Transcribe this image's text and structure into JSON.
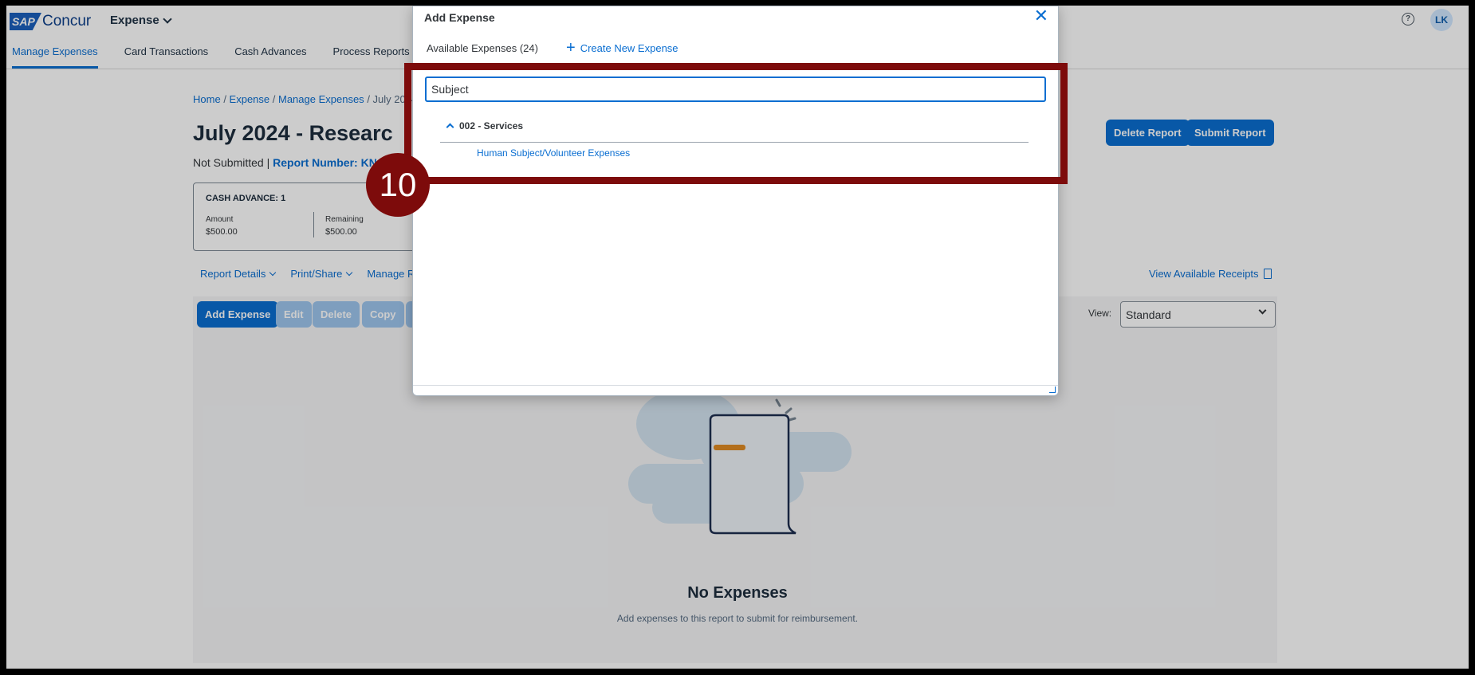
{
  "header": {
    "logo_sap": "SAP",
    "logo_concur": "Concur",
    "app_switcher": "Expense",
    "user_initials": "LK",
    "help_glyph": "?"
  },
  "nav": {
    "items": [
      "Manage Expenses",
      "Card Transactions",
      "Cash Advances",
      "Process Reports"
    ],
    "active_index": 0
  },
  "breadcrumb": {
    "home": "Home",
    "expense": "Expense",
    "manage": "Manage Expenses",
    "current": "July 2024 -"
  },
  "report": {
    "title": "July 2024 - Researc",
    "status": "Not Submitted |",
    "number_label": "Report Number: KN",
    "delete_button": "Delete Report",
    "submit_button": "Submit Report"
  },
  "cash_advance": {
    "title": "CASH ADVANCE: 1",
    "amount_label": "Amount",
    "amount_value": "$500.00",
    "remaining_label": "Remaining",
    "remaining_value": "$500.00"
  },
  "toolbar": {
    "report_details": "Report Details",
    "print_share": "Print/Share",
    "manage": "Manage R",
    "view_receipts": "View Available Receipts",
    "add_expense": "Add Expense",
    "edit": "Edit",
    "delete": "Delete",
    "copy": "Copy",
    "view_label": "View:",
    "view_value": "Standard"
  },
  "empty_state": {
    "title": "No Expenses",
    "subtitle": "Add expenses to this report to submit for reimbursement."
  },
  "modal": {
    "title": "Add Expense",
    "close_glyph": "✕",
    "available": "Available Expenses (24)",
    "create_new": "Create New Expense",
    "search_value": "Subject",
    "group_label": "002 - Services",
    "option": "Human Subject/Volunteer Expenses"
  },
  "annotation": {
    "step": "10",
    "color": "#7d0b0b"
  },
  "colors": {
    "accent": "#0a6ed1",
    "disabled_button": "#9ec6ee"
  }
}
